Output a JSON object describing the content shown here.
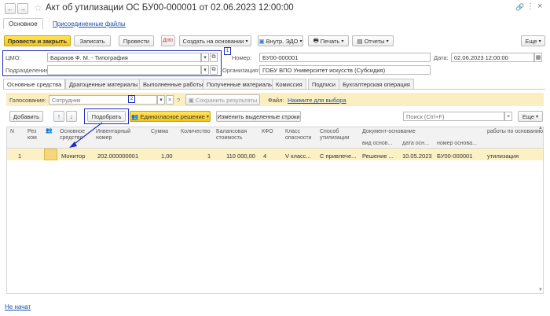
{
  "window": {
    "title": "Акт об утилизации ОС БУ00-000001 от 02.06.2023 12:00:00"
  },
  "nav": {
    "back": "←",
    "forward": "→"
  },
  "section_tabs": {
    "main": "Основное",
    "files": "Присоединенные файлы"
  },
  "toolbar": {
    "post_close": "Провести и закрыть",
    "save": "Записать",
    "post": "Провести",
    "create_based": "Создать на основании",
    "edo": "Внутр. ЭДО",
    "print": "Печать",
    "reports": "Отчеты",
    "more": "Еще"
  },
  "form": {
    "cmo_label": "ЦМО:",
    "cmo_value": "Баранов Ф. М. - Типография",
    "dept_label": "Подразделение:",
    "dept_value": "",
    "number_label": "Номер:",
    "number_value": "БУ00-000001",
    "date_label": "Дата:",
    "date_value": "02.06.2023 12:00:00",
    "org_label": "Организация:",
    "org_value": "ГОБУ ВПО Университет искусств (Субсидия)"
  },
  "tabs": [
    "Основные средства",
    "Драгоценные материалы",
    "Выполненные работы",
    "Полученные материалы",
    "Комиссия",
    "Подписи",
    "Бухгалтерская операция"
  ],
  "voting": {
    "label": "Голосование:",
    "placeholder": "Сотрудник",
    "help": "?",
    "save_results": "Сохранить результаты",
    "file_label": "Файл:",
    "file_link": "Нажмите для выбора"
  },
  "table_toolbar": {
    "add": "Добавить",
    "up": "↑",
    "down": "↓",
    "pick": "Подобрать",
    "unanimous": "Единогласное решение",
    "change_rows": "Изменить выделенные строки",
    "search_placeholder": "Поиск (Ctrl+F)",
    "clear": "×",
    "more": "Еще"
  },
  "table": {
    "headers": {
      "n": "N",
      "reserve": "Рез ком",
      "asset": "Основное средство",
      "inv": "Инвентарный номер",
      "sum": "Сумма",
      "qty": "Количество",
      "balance": "Балансовая стоимость",
      "kfo": "КФО",
      "danger": "Класс опасности",
      "method": "Способ утилизации",
      "doc_base": "Документ-основание",
      "doc_type": "вид основ...",
      "doc_date": "дата осн...",
      "doc_number": "номер основа...",
      "works": "работы по основанию"
    },
    "row": {
      "n": "1",
      "asset": "Монитор",
      "inv": "202.000000001",
      "sum": "1,00",
      "qty": "1",
      "balance": "110 000,00",
      "kfo": "4",
      "danger": "V класс...",
      "method": "С привлече...",
      "doc_type": "Решение ...",
      "doc_date": "10.05.2023",
      "doc_number": "БУ00-000001",
      "works": "утилизация"
    }
  },
  "markers": {
    "m1": "1",
    "m2": "2"
  },
  "footer": {
    "status": "Не начат"
  },
  "colors": {
    "accent": "#f5c518",
    "highlight": "#1f2dbf",
    "row_selected": "#fbf1c4",
    "voting_bg": "#fbeec1"
  }
}
